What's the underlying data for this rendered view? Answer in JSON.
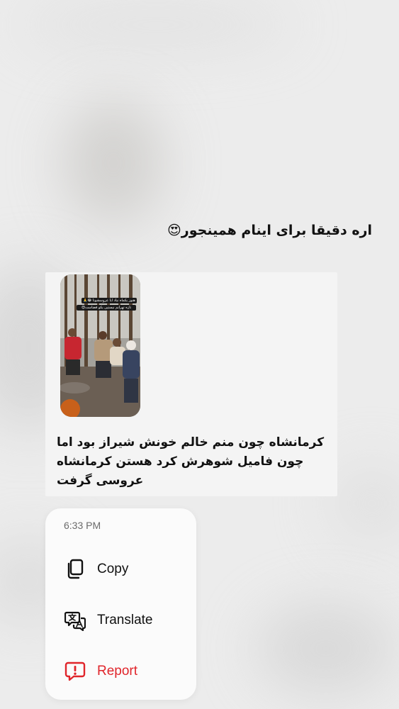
{
  "incoming_message": {
    "text": "اره دقیقا برای اینام همینجور😍"
  },
  "reply": {
    "media": "group-photo-thumbnail",
    "photo_caption_line1": "هنوز یکماه نیاد ایا عروسشونا 😂🙏",
    "photo_caption_line2": "تازه تهرانم نیستین یکو فضاست😍",
    "text_lines": [
      "کرمانشاه چون منم خالم خونش شیراز بود اما",
      "چون فامیل شوهرش کرد هستن کرمانشاه",
      "عروسی گرفت"
    ]
  },
  "context_menu": {
    "time": "6:33 PM",
    "items": [
      {
        "label": "Copy",
        "icon": "copy-icon"
      },
      {
        "label": "Translate",
        "icon": "translate-icon"
      },
      {
        "label": "Report",
        "icon": "report-icon",
        "color": "#e0252b"
      }
    ]
  }
}
